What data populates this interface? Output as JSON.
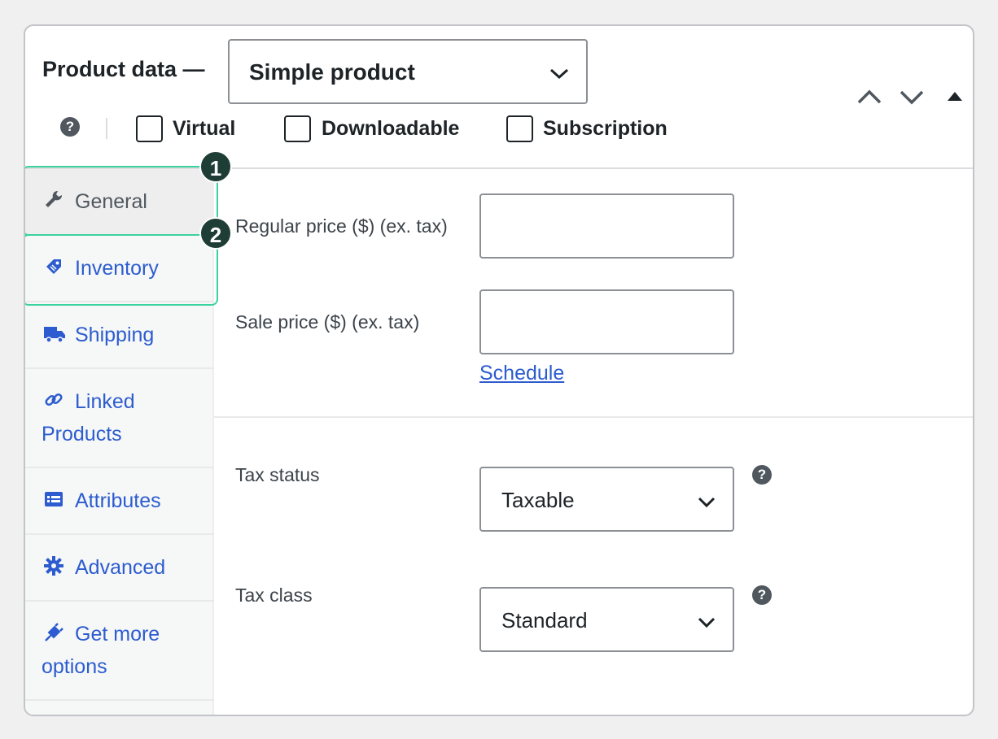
{
  "header": {
    "title": "Product data —",
    "product_type": "Simple product",
    "options": [
      {
        "label": "Virtual",
        "checked": false
      },
      {
        "label": "Downloadable",
        "checked": false
      },
      {
        "label": "Subscription",
        "checked": false
      }
    ]
  },
  "tabs": [
    {
      "label": "General",
      "icon": "wrench-icon",
      "active": true
    },
    {
      "label": "Inventory",
      "icon": "tag-icon",
      "active": false
    },
    {
      "label": "Shipping",
      "icon": "truck-icon",
      "active": false
    },
    {
      "label": "Linked",
      "label2": "Products",
      "icon": "link-icon",
      "active": false
    },
    {
      "label": "Attributes",
      "icon": "list-icon",
      "active": false
    },
    {
      "label": "Advanced",
      "icon": "gear-icon",
      "active": false
    },
    {
      "label": "Get more",
      "label2": "options",
      "icon": "plug-icon",
      "active": false
    }
  ],
  "badges": [
    "1",
    "2"
  ],
  "fields": {
    "regular_price_label": "Regular price ($) (ex. tax)",
    "sale_price_label": "Sale price ($) (ex. tax)",
    "schedule_link": "Schedule",
    "tax_status_label": "Tax status",
    "tax_status_value": "Taxable",
    "tax_class_label": "Tax class",
    "tax_class_value": "Standard"
  },
  "colors": {
    "link": "#2c5ccf",
    "highlight": "#3ad29f",
    "badge": "#1e3d34"
  }
}
